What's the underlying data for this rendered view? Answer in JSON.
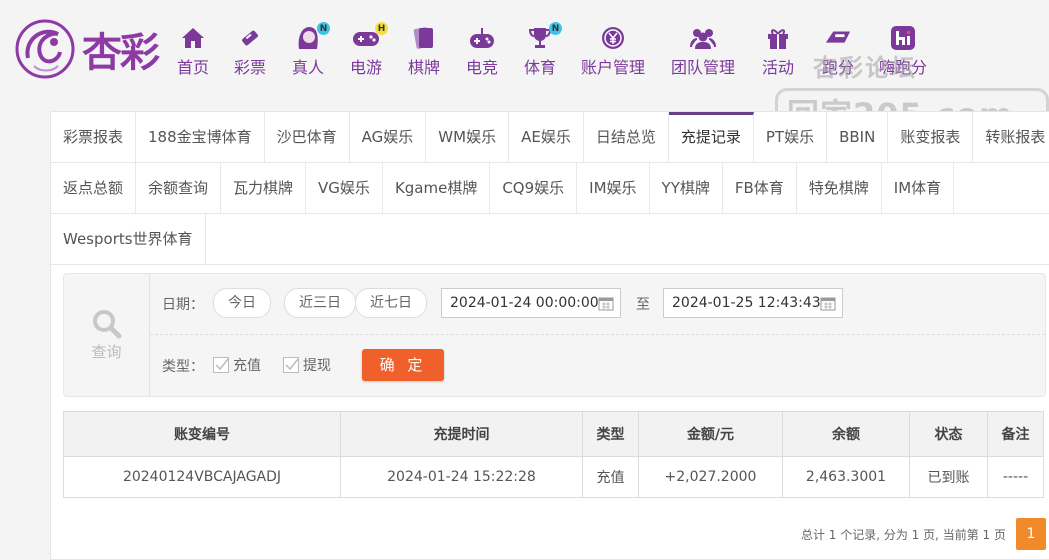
{
  "brand": {
    "logo_text": "杏彩"
  },
  "nav": [
    {
      "label": "首页",
      "icon": "home-icon"
    },
    {
      "label": "彩票",
      "icon": "lottery-icon"
    },
    {
      "label": "真人",
      "icon": "live-dealer-icon",
      "badge": "N"
    },
    {
      "label": "电游",
      "icon": "gamepad-icon",
      "badge": "H"
    },
    {
      "label": "棋牌",
      "icon": "cards-icon"
    },
    {
      "label": "电竞",
      "icon": "esports-controller-icon"
    },
    {
      "label": "体育",
      "icon": "trophy-icon",
      "badge": "N"
    },
    {
      "label": "账户管理",
      "icon": "yen-coin-icon"
    },
    {
      "label": "团队管理",
      "icon": "team-icon"
    },
    {
      "label": "活动",
      "icon": "gift-icon"
    },
    {
      "label": "跑分",
      "icon": "run-score-icon"
    },
    {
      "label": "嗨跑分",
      "icon": "hi-icon"
    }
  ],
  "watermark": {
    "top": "杏彩论坛",
    "bottom": "回家205.com"
  },
  "tabs_row1": [
    "彩票报表",
    "188金宝博体育",
    "沙巴体育",
    "AG娱乐",
    "WM娱乐",
    "AE娱乐",
    "日结总览",
    "充提记录",
    "PT娱乐",
    "BBIN",
    "账变报表",
    "转账报表"
  ],
  "tabs_row2": [
    "返点总额",
    "余额查询",
    "瓦力棋牌",
    "VG娱乐",
    "Kgame棋牌",
    "CQ9娱乐",
    "IM娱乐",
    "YY棋牌",
    "FB体育",
    "特免棋牌",
    "IM体育"
  ],
  "tabs_row3": [
    "Wesports世界体育"
  ],
  "active_tab": "充提记录",
  "query": {
    "icon_label": "查询",
    "date_label": "日期：",
    "quick": [
      "今日",
      "近三日",
      "近七日"
    ],
    "start": "2024-01-24 00:00:00",
    "to": "至",
    "end": "2024-01-25 12:43:43",
    "type_label": "类型：",
    "type_options": [
      "充值",
      "提现"
    ],
    "confirm": "确 定"
  },
  "table": {
    "headers": [
      "账变编号",
      "充提时间",
      "类型",
      "金额/元",
      "余额",
      "状态",
      "备注"
    ],
    "rows": [
      [
        "20240124VBCAJAGADJ",
        "2024-01-24 15:22:28",
        "充值",
        "+2,027.2000",
        "2,463.3001",
        "已到账",
        "-----"
      ]
    ]
  },
  "pager": {
    "summary": "总计 1 个记录, 分为 1 页, 当前第 1 页",
    "current": "1"
  },
  "colors": {
    "brand": "#7b3a9a",
    "confirm": "#f0602a",
    "amount": "#d0021b",
    "status_ok": "#2e9c2e",
    "pager": "#f08a2b"
  }
}
